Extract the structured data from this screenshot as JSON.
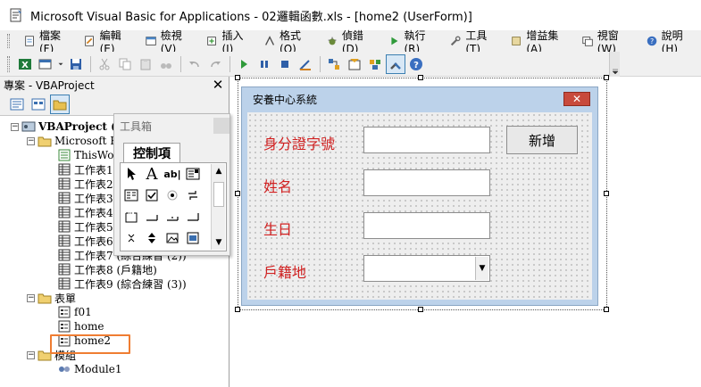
{
  "window": {
    "title": "Microsoft Visual Basic for Applications - 02邏輯函數.xls - [home2 (UserForm)]"
  },
  "menu": {
    "items": [
      {
        "label": "檔案(F)",
        "icon": "file-menu-icon"
      },
      {
        "label": "編輯(E)",
        "icon": "edit-menu-icon"
      },
      {
        "label": "檢視(V)",
        "icon": "view-menu-icon"
      },
      {
        "label": "插入(I)",
        "icon": "insert-menu-icon"
      },
      {
        "label": "格式(O)",
        "icon": "format-menu-icon"
      },
      {
        "label": "偵錯(D)",
        "icon": "debug-menu-icon"
      },
      {
        "label": "執行(R)",
        "icon": "run-menu-icon"
      },
      {
        "label": "工具(T)",
        "icon": "tools-menu-icon"
      },
      {
        "label": "增益集(A)",
        "icon": "addins-menu-icon"
      },
      {
        "label": "視窗(W)",
        "icon": "window-menu-icon"
      },
      {
        "label": "說明(H)",
        "icon": "help-menu-icon"
      }
    ]
  },
  "project_panel": {
    "title": "專案 - VBAProject",
    "tree": {
      "project": "VBAProject (0",
      "excel_objects": "Microsoft Ex",
      "sheets": [
        "ThisWor",
        "工作表1",
        "工作表2",
        "工作表3",
        "工作表4",
        "工作表5",
        "工作表6",
        "工作表7 (綜合練習 (2))",
        "工作表8 (戶籍地)",
        "工作表9 (綜合練習 (3))"
      ],
      "forms_folder": "表單",
      "forms": [
        "f01",
        "home",
        "home2"
      ],
      "modules_folder": "模組",
      "modules": [
        "Module1"
      ]
    }
  },
  "toolbox": {
    "title": "工具箱",
    "tab": "控制項",
    "label_tool": "A",
    "textbox_tool": "ab|"
  },
  "userform": {
    "caption": "安養中心系統",
    "close_glyph": "✕",
    "labels": {
      "id": "身分證字號",
      "name": "姓名",
      "birthday": "生日",
      "residence": "戶籍地"
    },
    "add_button": "新增",
    "combo_arrow": "▼"
  },
  "colors": {
    "label_text": "#d02020",
    "form_border": "#bcd2ea",
    "highlight": "#ef7d32"
  }
}
